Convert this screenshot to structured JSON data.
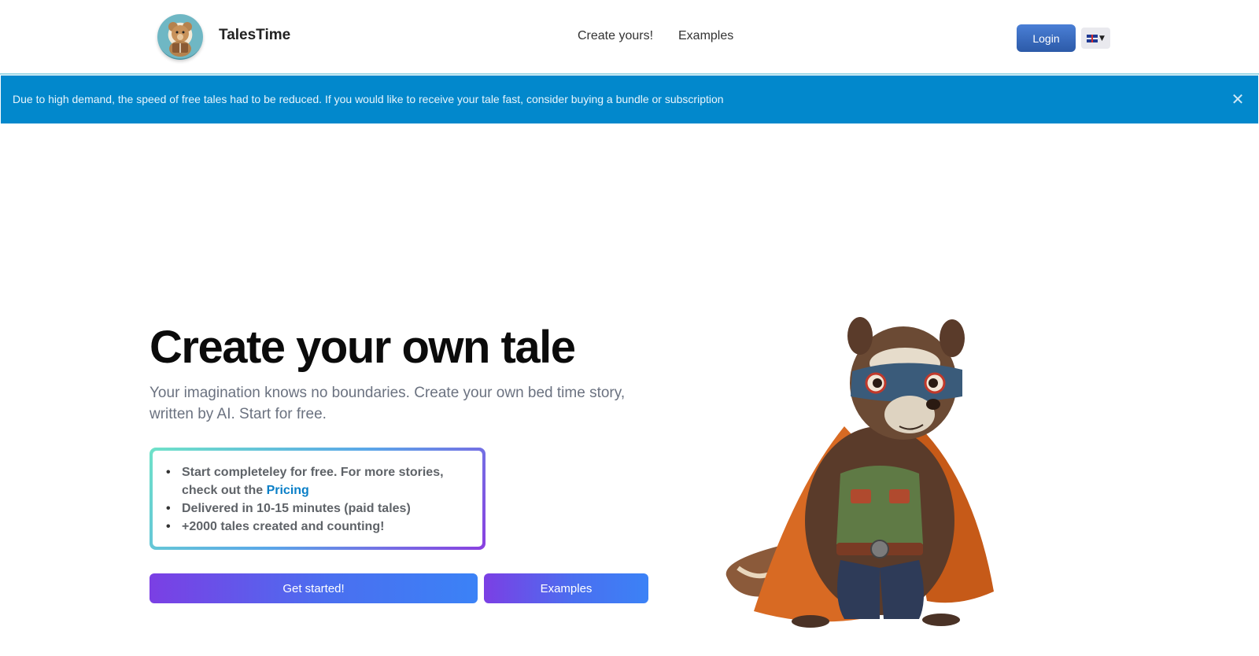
{
  "header": {
    "brand": "TalesTime",
    "nav": {
      "create": "Create yours!",
      "examples": "Examples"
    },
    "login_label": "Login",
    "language": {
      "icon": "uk-flag-icon",
      "selected": "🇬🇧"
    }
  },
  "banner": {
    "message": "Due to high demand, the speed of free tales had to be reduced. If you would like to receive your tale fast, consider buying a bundle or subscription",
    "close_icon": "close-icon",
    "color": "#0288cc"
  },
  "hero": {
    "title": "Create your own tale",
    "subtitle": "Your imagination knows no boundaries. Create your own bed time story, written by AI. Start for free.",
    "features": {
      "item1_text": "Start completeley for free. For more stories, check out the ",
      "item1_link": "Pricing",
      "item2": "Delivered in 10-15 minutes (paid tales)",
      "item3": "+2000 tales created and counting!"
    },
    "buttons": {
      "start": "Get started!",
      "examples": "Examples"
    }
  },
  "colors": {
    "accent_blue": "#0288cc",
    "button_gradient_start": "#7b3fe4",
    "button_gradient_end": "#3b82f6",
    "login": "#2c5aa8"
  }
}
